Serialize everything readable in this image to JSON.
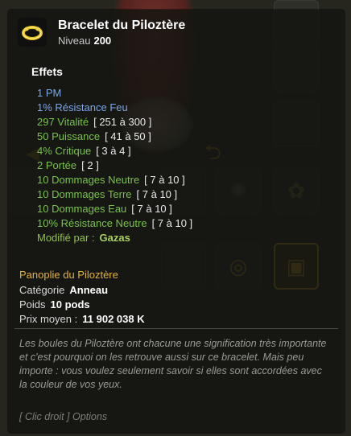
{
  "item": {
    "name": "Bracelet du Piloztère",
    "level_label": "Niveau",
    "level": "200",
    "icon": "gold-bracelet-icon"
  },
  "effects_title": "Effets",
  "effects": [
    {
      "text": "1 PM",
      "range": "",
      "color": "#7aa6e8"
    },
    {
      "text": "1% Résistance Feu",
      "range": "",
      "color": "#7aa6e8"
    },
    {
      "text": "297 Vitalité",
      "range": "[ 251 à 300 ]",
      "color": "#79c24a"
    },
    {
      "text": "50 Puissance",
      "range": "[ 41 à 50 ]",
      "color": "#79c24a"
    },
    {
      "text": "4% Critique",
      "range": "[ 3 à 4 ]",
      "color": "#79c24a"
    },
    {
      "text": "2 Portée",
      "range": "[ 2 ]",
      "color": "#79c24a"
    },
    {
      "text": "10 Dommages Neutre",
      "range": "[ 7 à 10 ]",
      "color": "#79c24a"
    },
    {
      "text": "10 Dommages Terre",
      "range": "[ 7 à 10 ]",
      "color": "#79c24a"
    },
    {
      "text": "10 Dommages Eau",
      "range": "[ 7 à 10 ]",
      "color": "#79c24a"
    },
    {
      "text": "10% Résistance Neutre",
      "range": "[ 7 à 10 ]",
      "color": "#79c24a"
    }
  ],
  "modified": {
    "label": "Modifié par :",
    "by": "Gazas"
  },
  "panoplie": "Panoplie du Piloztère",
  "info": {
    "category_label": "Catégorie",
    "category": "Anneau",
    "weight_label": "Poids",
    "weight": "10 pods",
    "price_label": "Prix moyen :",
    "price": "11 902 038 K"
  },
  "description": "Les boules du Piloztère ont chacune une signification très importante et c'est pourquoi on les retrouve aussi sur ce bracelet. Mais peu importe : vous voulez seulement savoir si elles sont accordées avec la couleur de vos yeux.",
  "hint": "[ Clic droit ] Options"
}
